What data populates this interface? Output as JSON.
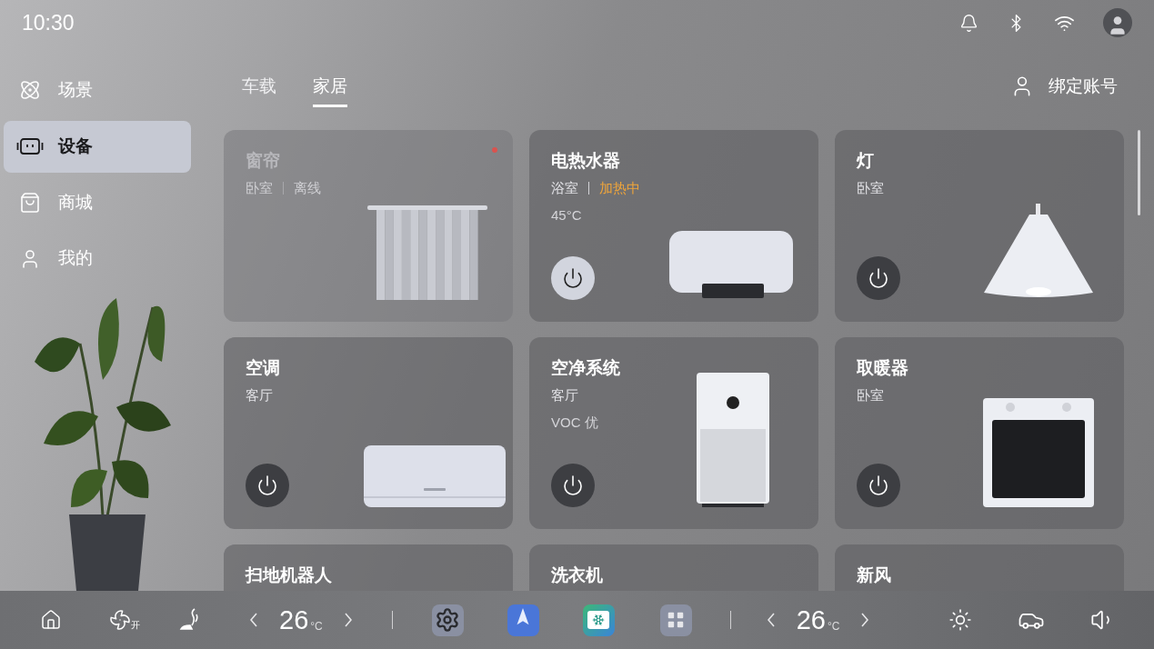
{
  "status_bar": {
    "time": "10:30"
  },
  "sidebar": {
    "items": [
      {
        "label": "场景",
        "selected": false
      },
      {
        "label": "设备",
        "selected": true
      },
      {
        "label": "商城",
        "selected": false
      },
      {
        "label": "我的",
        "selected": false
      }
    ]
  },
  "tabs": [
    {
      "label": "车载",
      "selected": false
    },
    {
      "label": "家居",
      "selected": true
    }
  ],
  "account": {
    "label": "绑定账号"
  },
  "devices": [
    {
      "kind": "curtain",
      "name": "窗帘",
      "room": "卧室",
      "status": {
        "text": "离线",
        "kind": "offline"
      },
      "offline": true,
      "alert": true
    },
    {
      "kind": "water-heater",
      "name": "电热水器",
      "room": "浴室",
      "status": {
        "text": "加热中",
        "kind": "heating"
      },
      "reading": "45°C",
      "offline": false,
      "alert": false,
      "power_on": true
    },
    {
      "kind": "lamp",
      "name": "灯",
      "room": "卧室",
      "offline": false,
      "alert": false,
      "power_on": false
    },
    {
      "kind": "air-conditioner",
      "name": "空调",
      "room": "客厅",
      "offline": false,
      "alert": false,
      "power_on": false
    },
    {
      "kind": "air-purifier",
      "name": "空净系统",
      "room": "客厅",
      "reading": "VOC 优",
      "offline": false,
      "alert": false,
      "power_on": false
    },
    {
      "kind": "heater",
      "name": "取暖器",
      "room": "卧室",
      "offline": false,
      "alert": false,
      "power_on": false
    },
    {
      "kind": "none",
      "name": "扫地机器人",
      "offline": false,
      "alert": false
    },
    {
      "kind": "none",
      "name": "洗衣机",
      "offline": false,
      "alert": false
    },
    {
      "kind": "none",
      "name": "新风",
      "offline": false,
      "alert": false
    }
  ],
  "bottom_bar": {
    "fan_label": "开",
    "left_temp": {
      "value": "26",
      "unit": "°C"
    },
    "right_temp": {
      "value": "26",
      "unit": "°C"
    }
  }
}
